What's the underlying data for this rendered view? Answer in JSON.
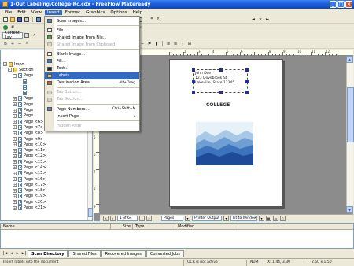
{
  "window": {
    "title": "1-Out Labeling\\College-Rc.cdx - FreeFlow Makeready",
    "min": "_",
    "max": "□",
    "close": "×"
  },
  "menubar": [
    "File",
    "Edit",
    "View",
    "Insert",
    "Format",
    "Graphics",
    "Options",
    "Help"
  ],
  "toolbar": {
    "combo_current": "Current Lay",
    "combo_left": "",
    "zoom_combo": "Fit",
    "tools": [
      "new",
      "open",
      "save",
      "print",
      "undo",
      "redo",
      "cut",
      "copy",
      "paste",
      "zoom",
      "rotate",
      "align"
    ]
  },
  "insert_menu": {
    "items": [
      {
        "label": "Scan Images...",
        "icon": "scanner-icon",
        "disabled": false
      },
      {
        "label": "",
        "separator": true
      },
      {
        "label": "File...",
        "icon": "file-icon",
        "disabled": false
      },
      {
        "label": "Shared Image From File...",
        "icon": "image-icon",
        "disabled": false
      },
      {
        "label": "Shared Image From Clipboard",
        "icon": "clipboard-icon",
        "disabled": true
      },
      {
        "label": "",
        "separator": true
      },
      {
        "label": "Blank Image...",
        "icon": "blank-page-icon",
        "disabled": false
      },
      {
        "label": "Fill...",
        "icon": "fill-icon",
        "disabled": false
      },
      {
        "label": "Text...",
        "icon": "text-icon",
        "disabled": false
      },
      {
        "label": "Labels...",
        "icon": "label-icon",
        "disabled": false,
        "highlight": true
      },
      {
        "label": "Destination Area...",
        "icon": "destination-icon",
        "disabled": false,
        "shortcut": "Alt+Drag"
      },
      {
        "label": "",
        "separator": true
      },
      {
        "label": "Tab Button...",
        "icon": "tab-icon",
        "disabled": true
      },
      {
        "label": "Tab Section...",
        "icon": "tab-section-icon",
        "disabled": true
      },
      {
        "label": "",
        "separator": true
      },
      {
        "label": "Page Numbers...",
        "icon": "page-number-icon",
        "disabled": false,
        "shortcut": "Ctrl+Shift+N"
      },
      {
        "label": "Insert Page",
        "icon": "",
        "disabled": false,
        "submenu": true
      },
      {
        "label": "",
        "separator": true
      },
      {
        "label": "Hidden Page",
        "icon": "",
        "disabled": true
      }
    ]
  },
  "tree": {
    "rows": [
      {
        "label": "Impo",
        "indent": 0,
        "expander": "-",
        "folder": true
      },
      {
        "label": "Section",
        "indent": 1,
        "expander": "-",
        "folder": true
      },
      {
        "label": "Page",
        "indent": 2,
        "expander": "-",
        "folder": false
      },
      {
        "label": "",
        "indent": 3,
        "expander": "",
        "folder": false
      },
      {
        "label": "",
        "indent": 3,
        "expander": "",
        "folder": false
      },
      {
        "label": "",
        "indent": 3,
        "expander": "",
        "folder": false
      },
      {
        "label": "Page",
        "indent": 2,
        "expander": "+",
        "folder": false
      },
      {
        "label": "Page",
        "indent": 2,
        "expander": "+",
        "folder": false
      },
      {
        "label": "Page",
        "indent": 2,
        "expander": "+",
        "folder": false
      },
      {
        "label": "Page",
        "indent": 2,
        "expander": "+",
        "folder": false
      },
      {
        "label": "Page <6>",
        "indent": 2,
        "expander": "+",
        "folder": false
      },
      {
        "label": "Page <7>",
        "indent": 2,
        "expander": "+",
        "folder": false
      },
      {
        "label": "Page <8>",
        "indent": 2,
        "expander": "+",
        "folder": false
      },
      {
        "label": "Page <9>",
        "indent": 2,
        "expander": "+",
        "folder": false
      },
      {
        "label": "Page <10>",
        "indent": 2,
        "expander": "+",
        "folder": false
      },
      {
        "label": "Page <11>",
        "indent": 2,
        "expander": "+",
        "folder": false
      },
      {
        "label": "Page <12>",
        "indent": 2,
        "expander": "+",
        "folder": false
      },
      {
        "label": "Page <13>",
        "indent": 2,
        "expander": "+",
        "folder": false
      },
      {
        "label": "Page <14>",
        "indent": 2,
        "expander": "+",
        "folder": false
      },
      {
        "label": "Page <15>",
        "indent": 2,
        "expander": "+",
        "folder": false
      },
      {
        "label": "Page <16>",
        "indent": 2,
        "expander": "+",
        "folder": false
      },
      {
        "label": "Page <17>",
        "indent": 2,
        "expander": "+",
        "folder": false
      },
      {
        "label": "Page <18>",
        "indent": 2,
        "expander": "+",
        "folder": false
      },
      {
        "label": "Page <19>",
        "indent": 2,
        "expander": "+",
        "folder": false
      },
      {
        "label": "Page <20>",
        "indent": 2,
        "expander": "+",
        "folder": false
      },
      {
        "label": "Page <21>",
        "indent": 2,
        "expander": "+",
        "folder": false
      }
    ]
  },
  "document": {
    "address_lines": [
      "John Doe",
      "123 Dovebrook St",
      "Lakeville, State 12345"
    ],
    "college_text": "COLLEGE"
  },
  "ruler": {
    "h_labels": [
      "1",
      "2",
      "3",
      "4",
      "5",
      "6",
      "7",
      "8",
      "9",
      "10",
      "11",
      "12"
    ],
    "v_labels": [
      "1",
      "2",
      "3",
      "4",
      "5",
      "6",
      "7",
      "8",
      "9"
    ]
  },
  "canvas_status": {
    "page_of": "1 of 64",
    "view_mode": "Pages",
    "output": "Printer Output",
    "fit": "Fit to Window"
  },
  "filelist": {
    "columns": [
      "Name",
      "Size",
      "Type",
      "Modified"
    ]
  },
  "tabs": {
    "nav": [
      "|◄",
      "◄",
      "►",
      "►|"
    ],
    "items": [
      {
        "label": "Scan Directory",
        "active": true
      },
      {
        "label": "Shared Files",
        "active": false
      },
      {
        "label": "Recovered Images",
        "active": false
      },
      {
        "label": "Converted Jobs",
        "active": false
      }
    ]
  },
  "statusbar": {
    "left": "Insert labels into the document",
    "ocr": "OCR is not active",
    "num": "NUM",
    "coords": "X: 1.44, 3.30",
    "size": "2.50 x 1.50"
  },
  "colors": {
    "titlebar": "#0d46c1",
    "highlight": "#316ac5",
    "selection_handle": "#2030a0"
  }
}
